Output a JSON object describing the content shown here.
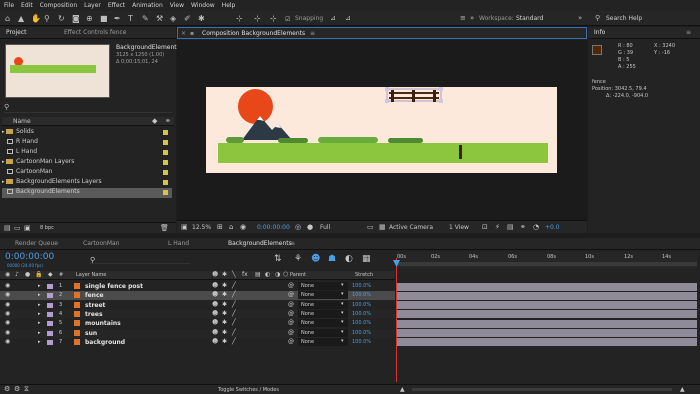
{
  "menu": [
    "File",
    "Edit",
    "Composition",
    "Layer",
    "Effect",
    "Animation",
    "View",
    "Window",
    "Help"
  ],
  "toolbar": {
    "snapping_label": "Snapping",
    "workspace_label": "Workspace:",
    "workspace_value": "Standard",
    "search_label": "Search Help"
  },
  "project_panel": {
    "tab_project": "Project",
    "tab_effect": "Effect Controls fence",
    "selected_name": "BackgroundElements",
    "selected_dims": "3125 x 1250 (1.00)",
    "selected_duration": "Δ 0;00;15;01, 24",
    "column_name": "Name",
    "items": [
      {
        "name": "Solids",
        "type": "folder"
      },
      {
        "name": "R Hand",
        "type": "file"
      },
      {
        "name": "L Hand",
        "type": "file"
      },
      {
        "name": "CartoonMan Layers",
        "type": "folder"
      },
      {
        "name": "CartoonMan",
        "type": "file"
      },
      {
        "name": "BackgroundElements Layers",
        "type": "folder"
      },
      {
        "name": "BackgroundElements",
        "type": "file"
      }
    ],
    "bpc": "8 bpc"
  },
  "comp_panel": {
    "tab_label": "Composition BackgroundElements",
    "zoom": "12.5%",
    "timecode": "0:00:00:00",
    "resolution": "Full",
    "camera": "Active Camera",
    "views": "1 View",
    "exposure": "+0.0"
  },
  "info_panel": {
    "tab": "Info",
    "r": "R : 80",
    "g": "G : 39",
    "b": "B : 5",
    "a": "A : 255",
    "x": "X : 3240",
    "y": "Y : -16",
    "layer": "fence",
    "position": "Position: 3042.5, 79.4",
    "delta": "Δ: -224.0, -904.0",
    "swatch_color": "#502705"
  },
  "timeline": {
    "tabs": [
      "Render Queue",
      "CartoonMan",
      "L Hand",
      "BackgroundElements"
    ],
    "timecode": "0:00:00:00",
    "fps": "00000 (24.00 fps)",
    "columns": {
      "num": "#",
      "layer_name": "Layer Name",
      "parent": "Parent",
      "stretch": "Stretch"
    },
    "ruler": [
      "00s",
      "02s",
      "04s",
      "06s",
      "08s",
      "10s",
      "12s",
      "14s"
    ],
    "layers": [
      {
        "num": "1",
        "name": "single fence post",
        "parent": "None",
        "stretch": "100.0%",
        "color": "#b39cd0"
      },
      {
        "num": "2",
        "name": "fence",
        "parent": "None",
        "stretch": "100.0%",
        "color": "#b39cd0"
      },
      {
        "num": "3",
        "name": "street",
        "parent": "None",
        "stretch": "100.0%",
        "color": "#b39cd0"
      },
      {
        "num": "4",
        "name": "trees",
        "parent": "None",
        "stretch": "100.0%",
        "color": "#b39cd0"
      },
      {
        "num": "5",
        "name": "mountains",
        "parent": "None",
        "stretch": "100.0%",
        "color": "#b39cd0"
      },
      {
        "num": "6",
        "name": "sun",
        "parent": "None",
        "stretch": "100.0%",
        "color": "#b39cd0"
      },
      {
        "num": "7",
        "name": "background",
        "parent": "None",
        "stretch": "100.0%",
        "color": "#b39cd0"
      }
    ],
    "toggle_label": "Toggle Switches / Modes"
  }
}
